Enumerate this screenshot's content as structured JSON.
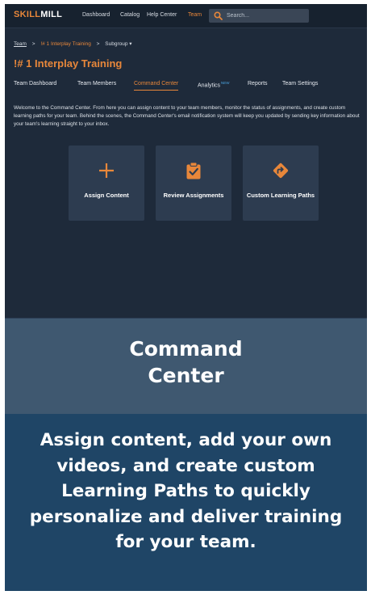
{
  "app": {
    "logo_part1": "SKILL",
    "logo_part2": "MILL"
  },
  "topnav": {
    "items": [
      {
        "label": "Dashboard"
      },
      {
        "label": "Catalog"
      },
      {
        "label": "Help Center"
      },
      {
        "label": "Team",
        "active": true
      }
    ],
    "search_placeholder": "Search..."
  },
  "breadcrumb": {
    "items": [
      "Team",
      "!# 1 Interplay Training",
      "Subgroup ▾"
    ],
    "separator": ">"
  },
  "page": {
    "title": "!# 1 Interplay Training"
  },
  "tabs": [
    {
      "label": "Team Dashboard"
    },
    {
      "label": "Team Members"
    },
    {
      "label": "Command Center",
      "active": true
    },
    {
      "label": "Analytics",
      "badge": "NEW"
    },
    {
      "label": "Reports"
    },
    {
      "label": "Team Settings"
    }
  ],
  "welcome_text": "Welcome to the Command Center. From here you can assign content to your team members, monitor the status of assignments, and create custom learning paths for your team. Behind the scenes, the Command Center's email notification system will keep you updated by sending key information about your team's learning straight to your inbox.",
  "cards": [
    {
      "label": "Assign Content",
      "icon": "plus-icon"
    },
    {
      "label": "Review Assignments",
      "icon": "clipboard-check-icon"
    },
    {
      "label": "Custom Learning Paths",
      "icon": "diamond-arrow-icon"
    }
  ],
  "caption": {
    "title": "Command Center",
    "body": "Assign content, add your own videos, and create custom Learning Paths to quickly personalize and deliver training for your team."
  },
  "colors": {
    "accent": "#e8873a",
    "background": "#1e2a3a",
    "card": "#2d3c50",
    "caption_head": "#3f5870",
    "caption_body": "#1f4566"
  }
}
